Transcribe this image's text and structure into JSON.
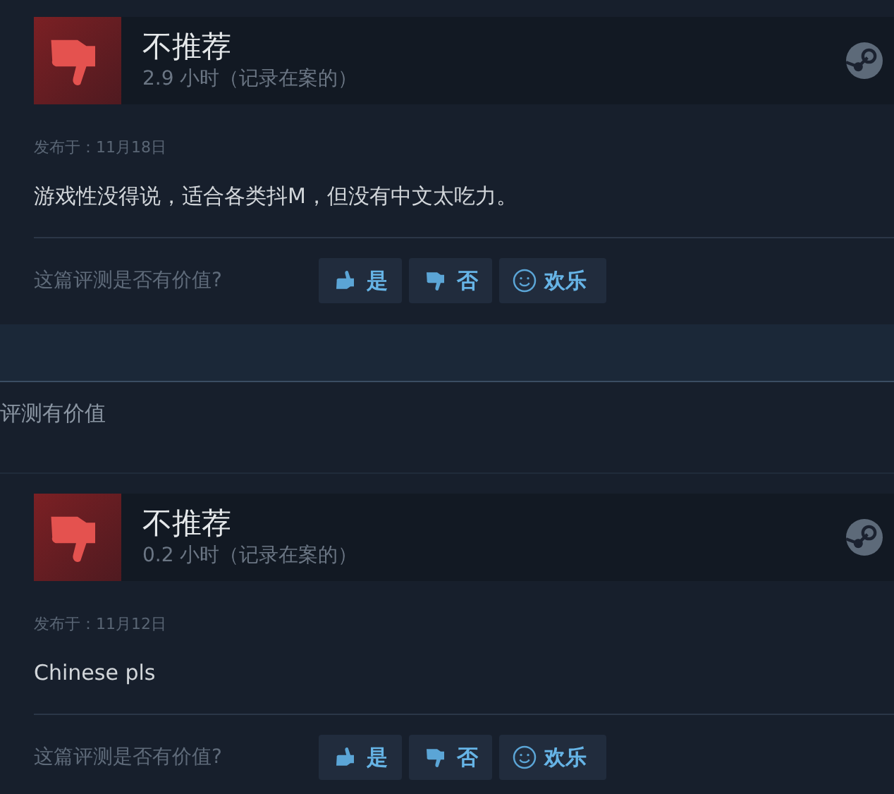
{
  "reviews": [
    {
      "recommended": false,
      "verdict": "不推荐",
      "hours": "2.9 小时（记录在案的）",
      "posted": "发布于：11月18日",
      "text": "游戏性没得说，适合各类抖M，但没有中文太吃力。",
      "helpful_prompt": "这篇评测是否有价值?",
      "buttons": [
        {
          "kind": "yes",
          "label": "是"
        },
        {
          "kind": "no",
          "label": "否"
        },
        {
          "kind": "funny",
          "label": "欢乐"
        }
      ]
    }
  ],
  "separator_text": "评测有价值",
  "reviews_2": [
    {
      "recommended": false,
      "verdict": "不推荐",
      "hours": "0.2 小时（记录在案的）",
      "posted": "发布于：11月12日",
      "text": "Chinese pls",
      "helpful_prompt": "这篇评测是否有价值?",
      "buttons": [
        {
          "kind": "yes",
          "label": "是"
        },
        {
          "kind": "no",
          "label": "否"
        },
        {
          "kind": "funny",
          "label": "欢乐"
        }
      ]
    }
  ]
}
